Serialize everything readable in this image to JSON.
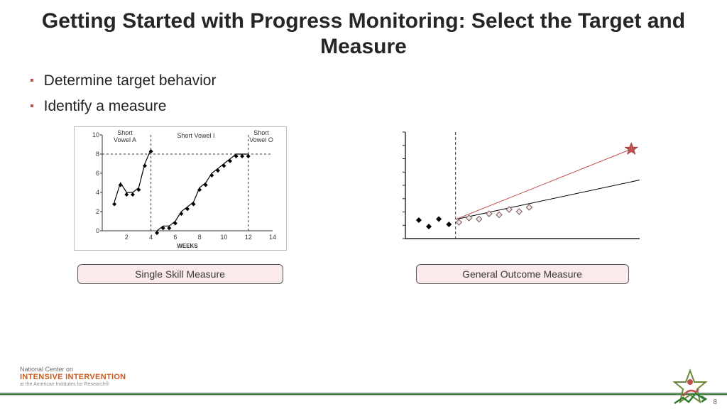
{
  "title": "Getting Started with Progress Monitoring: Select the Target and Measure",
  "bullets": [
    "Determine target behavior",
    "Identify a measure"
  ],
  "captions": {
    "left": "Single Skill Measure",
    "right": "General Outcome Measure"
  },
  "brand": {
    "line1": "National Center on",
    "line2": "INTENSIVE INTERVENTION",
    "line3": "at the American Institutes for Research®"
  },
  "page_number": "8",
  "chart_data": [
    {
      "type": "line",
      "title_segments": [
        "Short Vowel A",
        "Short Vowel I",
        "Short Vowel O"
      ],
      "xlabel": "WEEKS",
      "ylabel": "",
      "xlim": [
        0,
        14
      ],
      "ylim": [
        0,
        10
      ],
      "x_ticks": [
        2,
        4,
        6,
        8,
        10,
        12,
        14
      ],
      "y_ticks": [
        0,
        2,
        4,
        6,
        8,
        10
      ],
      "phase_dividers_x": [
        4,
        12
      ],
      "reference_line_y": 8,
      "series": [
        {
          "name": "Short Vowel A",
          "x": [
            1,
            1.5,
            2,
            2.5,
            3,
            3.5,
            4
          ],
          "y": [
            3,
            5,
            4,
            4,
            4.5,
            7,
            8.5
          ]
        },
        {
          "name": "Short Vowel I",
          "x": [
            4.5,
            5,
            5.5,
            6,
            6.5,
            7,
            7.5,
            8,
            8.5,
            9,
            9.5,
            10,
            10.5,
            11,
            11.5,
            12
          ],
          "y": [
            0,
            0.5,
            0.5,
            1,
            2,
            2.5,
            3,
            4.5,
            5,
            6,
            6.5,
            7,
            7.5,
            8,
            8,
            8
          ]
        },
        {
          "name": "Short Vowel O",
          "x": [],
          "y": []
        }
      ]
    },
    {
      "type": "line",
      "title": "",
      "xlabel": "",
      "ylabel": "",
      "xlim": [
        0,
        14
      ],
      "ylim": [
        0,
        10
      ],
      "baseline_divider_x": 3,
      "series": [
        {
          "name": "baseline",
          "x": [
            0.8,
            1.4,
            2,
            2.6
          ],
          "y": [
            2.0,
            1.4,
            2.1,
            1.6
          ],
          "marker": "diamond-filled"
        },
        {
          "name": "intervention",
          "x": [
            3.2,
            3.8,
            4.4,
            5.0,
            5.6,
            6.2,
            6.8,
            7.4
          ],
          "y": [
            1.8,
            2.2,
            2.1,
            2.6,
            2.5,
            3.0,
            2.8,
            3.2
          ],
          "marker": "diamond-open"
        },
        {
          "name": "trend",
          "x": [
            3,
            14
          ],
          "y": [
            1.8,
            5.5
          ]
        },
        {
          "name": "aimline",
          "x": [
            3,
            13.5
          ],
          "y": [
            1.8,
            8.4
          ],
          "goal_marker": "star"
        }
      ]
    }
  ]
}
